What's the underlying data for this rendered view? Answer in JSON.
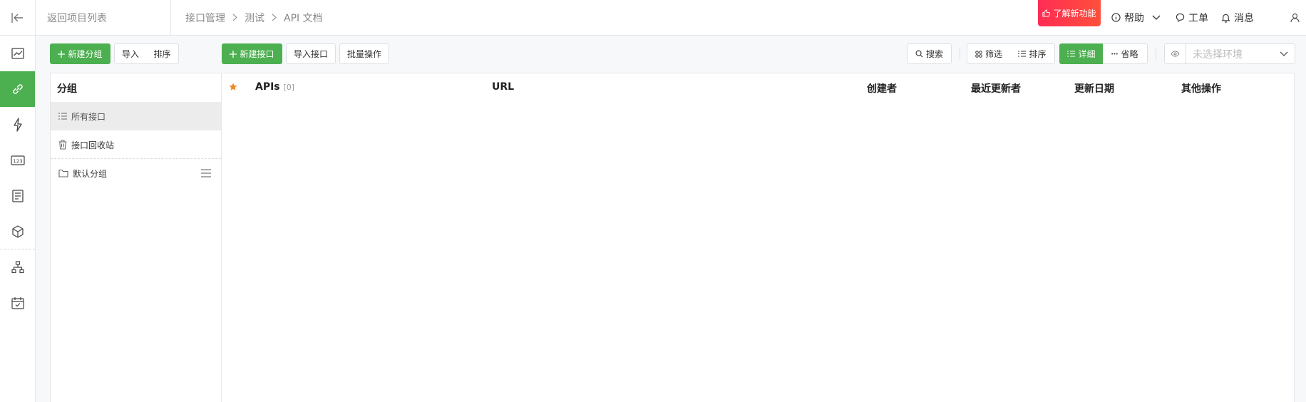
{
  "topbar": {
    "back_label": "返回项目列表",
    "breadcrumb": [
      "接口管理",
      "测试",
      "API 文档"
    ],
    "whats_new": "了解新功能",
    "help": "帮助",
    "ticket": "工单",
    "messages": "消息"
  },
  "leftnav": {
    "items": [
      "chart-icon",
      "link-icon",
      "bolt-icon",
      "number-icon",
      "document-icon",
      "cube-icon",
      "sitemap-icon",
      "calendar-icon"
    ],
    "active_index": 1,
    "accent_color": "#4caf50"
  },
  "toolbar": {
    "new_group": "新建分组",
    "import": "导入",
    "sort": "排序",
    "new_api": "新建接口",
    "import_api": "导入接口",
    "batch": "批量操作",
    "search": "搜索",
    "filter": "筛选",
    "sort2": "排序",
    "detail": "详细",
    "brief": "省略",
    "env_placeholder": "未选择环境"
  },
  "groups": {
    "title": "分组",
    "all": "所有接口",
    "recycle": "接口回收站",
    "default": "默认分组"
  },
  "api_table": {
    "apis_label": "APIs",
    "count": "[0]",
    "url": "URL",
    "creator": "创建者",
    "updater": "最近更新者",
    "date": "更新日期",
    "actions": "其他操作"
  }
}
